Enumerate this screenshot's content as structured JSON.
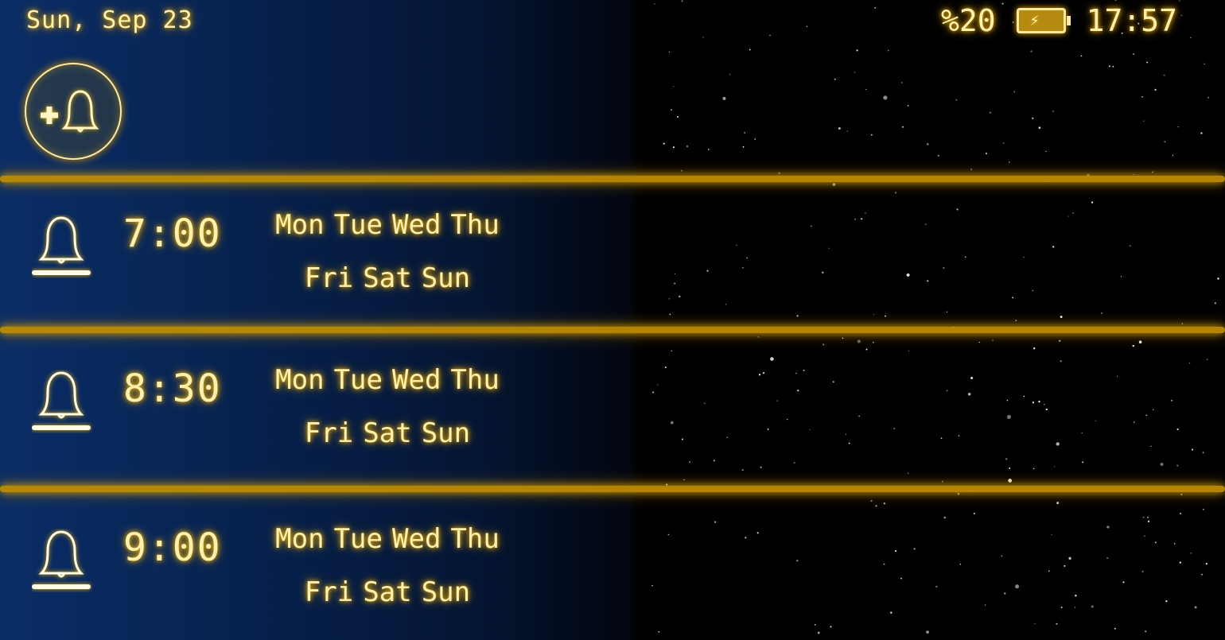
{
  "status_bar": {
    "date": "Sun, Sep 23",
    "battery_percent": "%20",
    "battery_level": 0.2,
    "battery_charging": true,
    "clock": "17:57"
  },
  "add_alarm": {
    "icon": "add-bell-icon"
  },
  "colors": {
    "accent": "#f5b800",
    "text": "#fff0b0",
    "background_left": "#0a2d66",
    "background_right": "#000000"
  },
  "alarms": [
    {
      "time": "7:00",
      "days_line1": [
        "Mon",
        "Tue",
        "Wed",
        "Thu"
      ],
      "days_line2": [
        "Fri",
        "Sat",
        "Sun"
      ],
      "icon": "bell-icon"
    },
    {
      "time": "8:30",
      "days_line1": [
        "Mon",
        "Tue",
        "Wed",
        "Thu"
      ],
      "days_line2": [
        "Fri",
        "Sat",
        "Sun"
      ],
      "icon": "bell-icon"
    },
    {
      "time": "9:00",
      "days_line1": [
        "Mon",
        "Tue",
        "Wed",
        "Thu"
      ],
      "days_line2": [
        "Fri",
        "Sat",
        "Sun"
      ],
      "icon": "bell-icon"
    }
  ]
}
